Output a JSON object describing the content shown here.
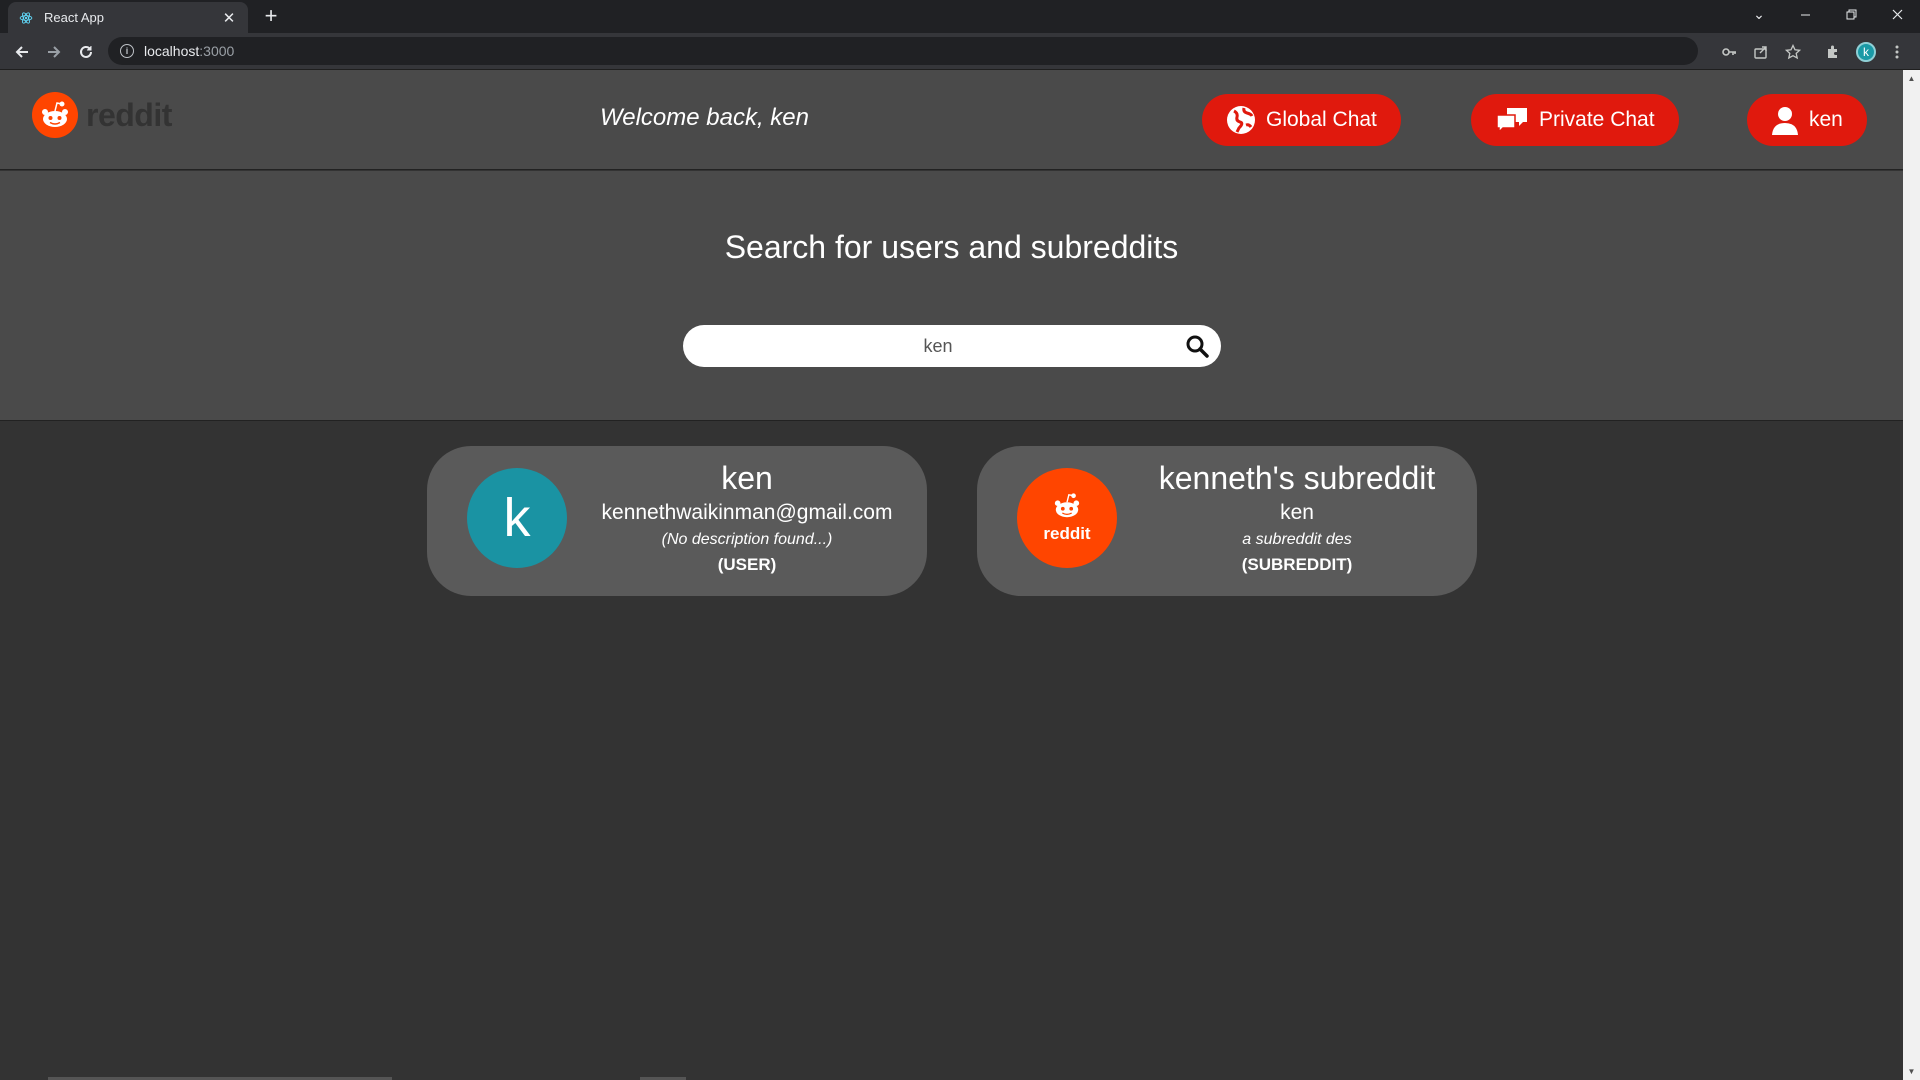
{
  "browser": {
    "tab_title": "React App",
    "tab_close": "✕",
    "new_tab": "+",
    "url_host": "localhost",
    "url_port": ":3000",
    "profile_initial": "k"
  },
  "header": {
    "logo_text": "reddit",
    "welcome": "Welcome back, ken",
    "global_chat": "Global Chat",
    "private_chat": "Private Chat",
    "user_button": "ken"
  },
  "search": {
    "heading": "Search for users and subreddits",
    "value": "ken"
  },
  "results": [
    {
      "avatar_letter": "k",
      "title": "ken",
      "subtitle": "kennethwaikinman@gmail.com",
      "description": "(No description found...)",
      "type": "(USER)"
    },
    {
      "avatar_text": "reddit",
      "title": "kenneth's subreddit",
      "subtitle": "ken",
      "description": "a subreddit des",
      "type": "(SUBREDDIT)"
    }
  ],
  "colors": {
    "accent": "#ff4500",
    "button_red": "#e0190d",
    "user_avatar": "#1a93a3",
    "header_bg": "#4a4a4a",
    "page_bg": "#333333",
    "card_bg": "#5a5a5a"
  }
}
